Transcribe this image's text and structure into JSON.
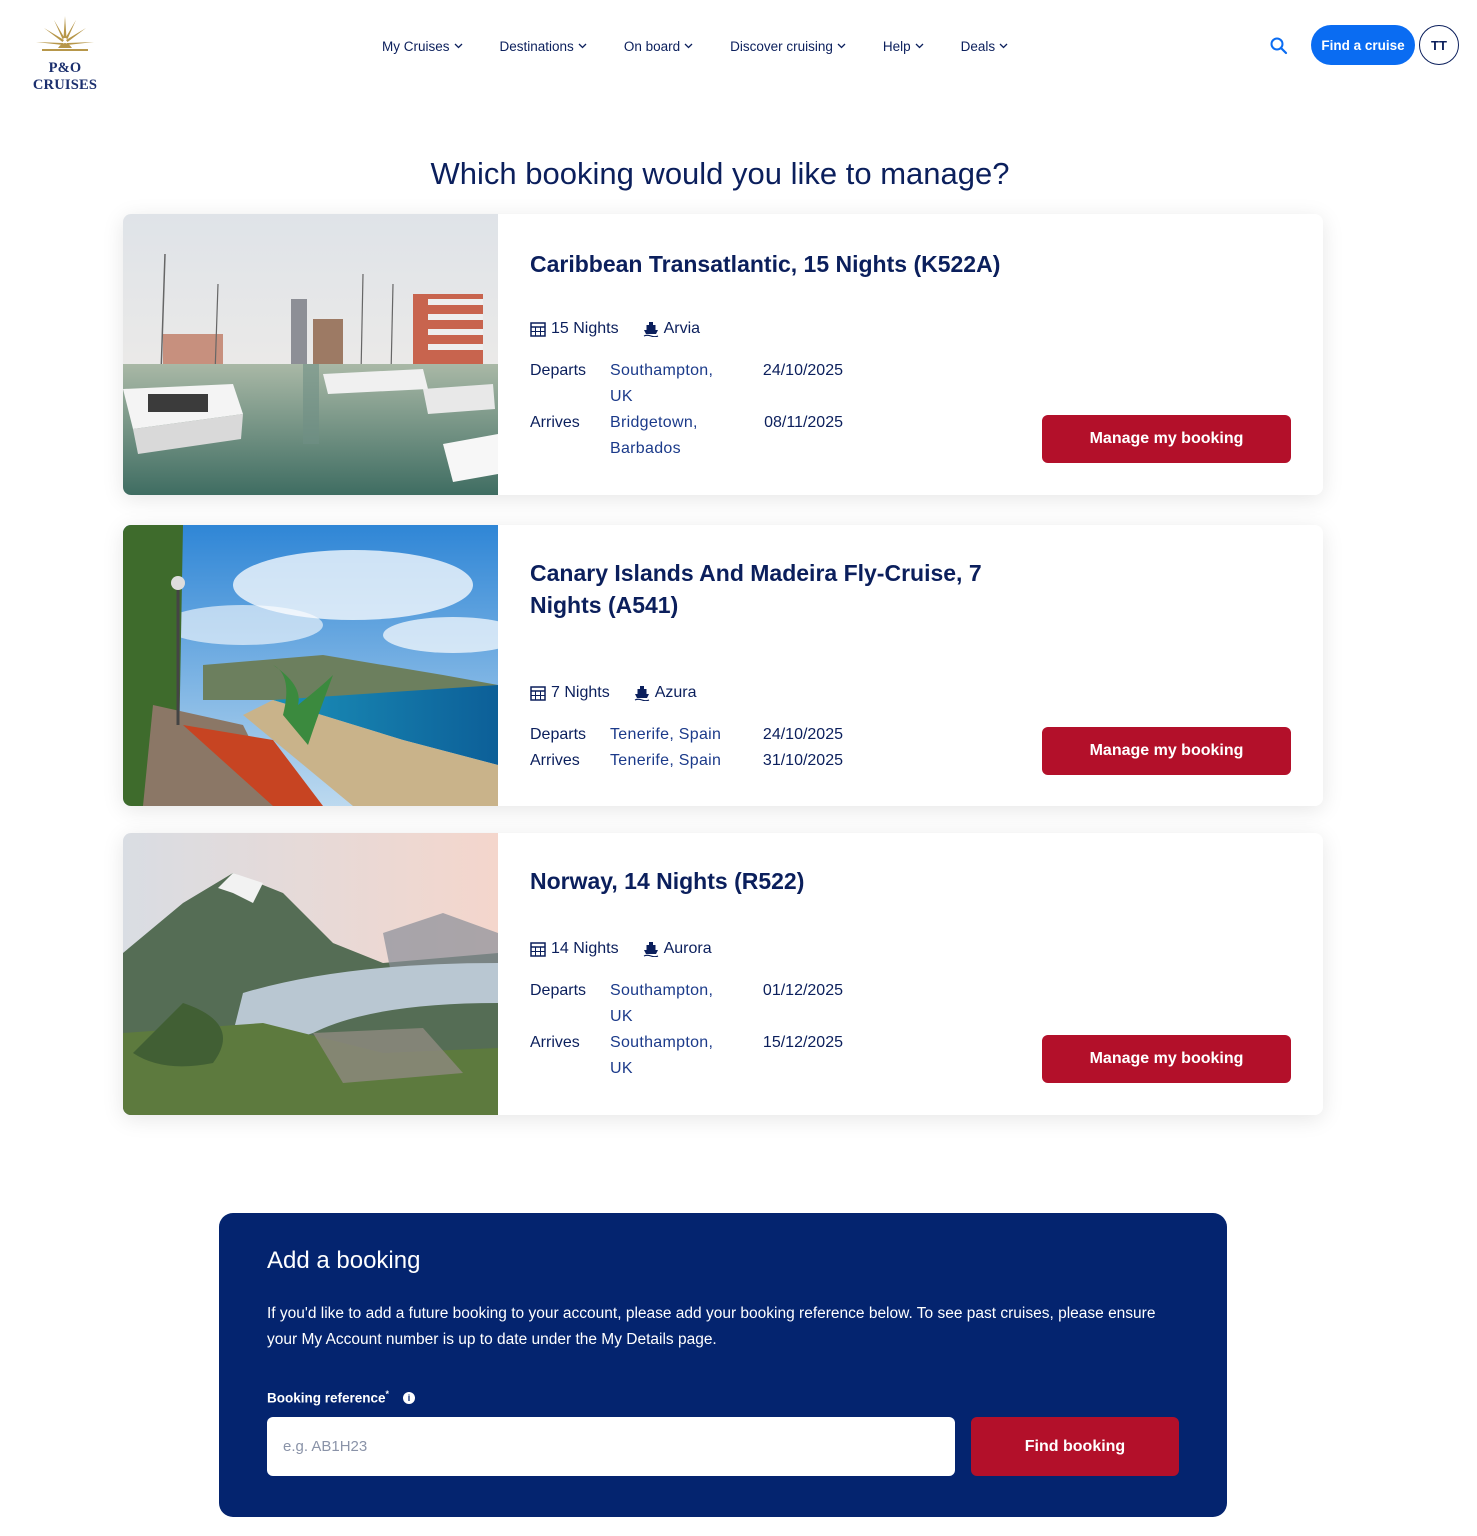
{
  "brand": {
    "logo_text": "P&O CRUISES"
  },
  "nav": {
    "items": [
      {
        "label": "My Cruises"
      },
      {
        "label": "Destinations"
      },
      {
        "label": "On board"
      },
      {
        "label": "Discover cruising"
      },
      {
        "label": "Help"
      },
      {
        "label": "Deals"
      }
    ],
    "find_cruise_label": "Find a cruise",
    "avatar_initials": "TT"
  },
  "page_title": "Which booking would you like to manage?",
  "bookings": [
    {
      "title": "Caribbean Transatlantic, 15 Nights (K522A)",
      "nights": "15 Nights",
      "ship": "Arvia",
      "departs_label": "Departs",
      "departs_port": "Southampton, UK",
      "departs_date": "24/10/2025",
      "arrives_label": "Arrives",
      "arrives_port": "Bridgetown, Barbados",
      "arrives_date": "08/11/2025",
      "button_label": "Manage my booking"
    },
    {
      "title": "Canary Islands And Madeira Fly-Cruise, 7 Nights (A541)",
      "nights": "7 Nights",
      "ship": "Azura",
      "departs_label": "Departs",
      "departs_port": "Tenerife, Spain",
      "departs_date": "24/10/2025",
      "arrives_label": "Arrives",
      "arrives_port": "Tenerife, Spain",
      "arrives_date": "31/10/2025",
      "button_label": "Manage my booking"
    },
    {
      "title": "Norway, 14 Nights (R522)",
      "nights": "14 Nights",
      "ship": "Aurora",
      "departs_label": "Departs",
      "departs_port": "Southampton, UK",
      "departs_date": "01/12/2025",
      "arrives_label": "Arrives",
      "arrives_port": "Southampton, UK",
      "arrives_date": "15/12/2025",
      "button_label": "Manage my booking"
    }
  ],
  "add_booking": {
    "title": "Add a booking",
    "description": "If you'd like to add a future booking to your account, please add your booking reference below. To see past cruises, please ensure your My Account number is up to date under the My Details page.",
    "field_label": "Booking reference",
    "required_mark": "*",
    "placeholder": "e.g. AB1H23",
    "button_label": "Find booking"
  },
  "colors": {
    "navy": "#0b1f5c",
    "panel": "#04246f",
    "cta_red": "#b3102a",
    "accent_blue": "#0a6cf2"
  }
}
